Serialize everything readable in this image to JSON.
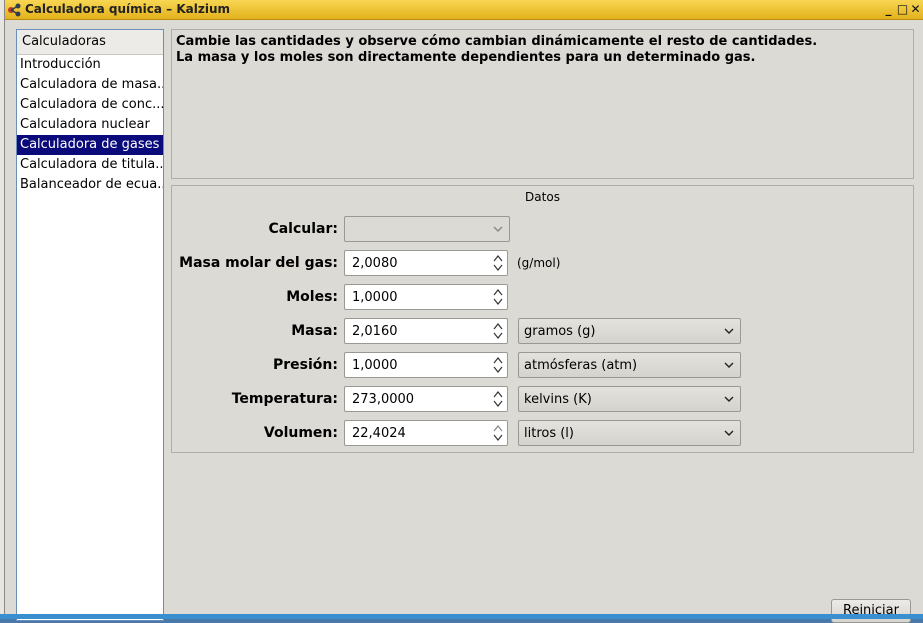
{
  "window": {
    "title": "Calculadora química – Kalzium"
  },
  "sidebar": {
    "header": "Calculadoras",
    "items": [
      {
        "label": "Introducción"
      },
      {
        "label": "Calculadora de masa..."
      },
      {
        "label": "Calculadora de conc..."
      },
      {
        "label": "Calculadora nuclear"
      },
      {
        "label": "Calculadora de gases",
        "selected": true
      },
      {
        "label": "Calculadora de titula..."
      },
      {
        "label": "Balanceador de ecua..."
      }
    ]
  },
  "description": {
    "line1": "Cambie las cantidades y observe cómo cambian dinámicamente el resto de cantidades.",
    "line2": "La masa y los moles son directamente dependientes para un determinado gas."
  },
  "datos": {
    "title": "Datos",
    "calcular": {
      "label": "Calcular:",
      "value": ""
    },
    "masa_molar": {
      "label": "Masa molar del gas:",
      "value": "2,0080",
      "unit": "(g/mol)"
    },
    "moles": {
      "label": "Moles:",
      "value": "1,0000"
    },
    "masa": {
      "label": "Masa:",
      "value": "2,0160",
      "unit": "gramos (g)"
    },
    "presion": {
      "label": "Presión:",
      "value": "1,0000",
      "unit": "atmósferas (atm)"
    },
    "temperatura": {
      "label": "Temperatura:",
      "value": "273,0000",
      "unit": "kelvins (K)"
    },
    "volumen": {
      "label": "Volumen:",
      "value": "22,4024",
      "unit": "litros (l)"
    }
  },
  "buttons": {
    "reset": "Reiniciar"
  }
}
